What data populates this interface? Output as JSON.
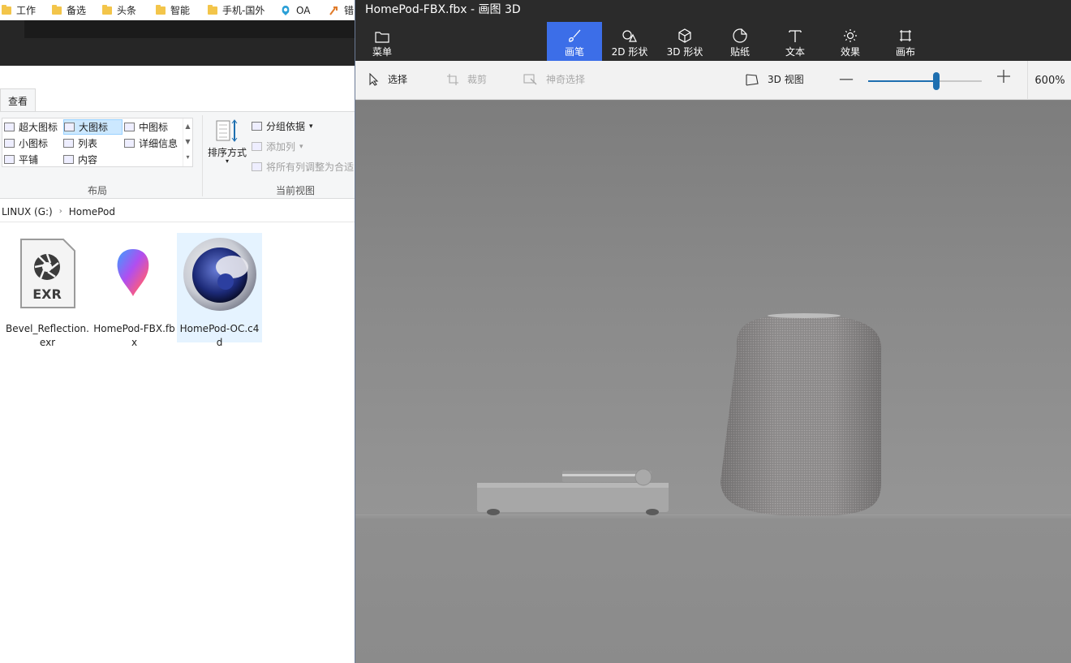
{
  "bookmarks": [
    {
      "label": "工作"
    },
    {
      "label": "备选"
    },
    {
      "label": "头条"
    },
    {
      "label": "智能"
    },
    {
      "label": "手机-国外"
    },
    {
      "label": "OA"
    },
    {
      "label": "错"
    }
  ],
  "explorer": {
    "tab_view": "查看",
    "layout_items": {
      "extra_large": "超大图标",
      "large": "大图标",
      "medium": "中图标",
      "small": "小图标",
      "list": "列表",
      "details": "详细信息",
      "tiles": "平铺",
      "content": "内容"
    },
    "layout_group": "布局",
    "sort_by": "排序方式",
    "group_by": "分组依据",
    "add_column": "添加列",
    "fit_columns": "将所有列调整为合适",
    "current_view_group": "当前视图",
    "address": {
      "drive": "LINUX (G:)",
      "folder": "HomePod"
    },
    "files": [
      {
        "name": "Bevel_Reflection.exr",
        "badge": "EXR"
      },
      {
        "name": "HomePod-FBX.fbx"
      },
      {
        "name": "HomePod-OC.c4d"
      }
    ]
  },
  "paint3d": {
    "title": "HomePod-FBX.fbx - 画图 3D",
    "menu": "菜单",
    "tools": [
      {
        "label": "画笔",
        "icon": "brush-icon"
      },
      {
        "label": "2D 形状",
        "icon": "2d-shapes-icon"
      },
      {
        "label": "3D 形状",
        "icon": "3d-shapes-icon"
      },
      {
        "label": "贴纸",
        "icon": "stickers-icon"
      },
      {
        "label": "文本",
        "icon": "text-icon"
      },
      {
        "label": "效果",
        "icon": "effects-icon"
      },
      {
        "label": "画布",
        "icon": "canvas-icon"
      }
    ],
    "select": "选择",
    "crop": "裁剪",
    "magic_select": "神奇选择",
    "view3d": "3D 视图",
    "zoom_label": "600%",
    "zoom_fraction": 0.6,
    "accent": "#3c6ee8",
    "slider_color": "#1e6fb0"
  }
}
